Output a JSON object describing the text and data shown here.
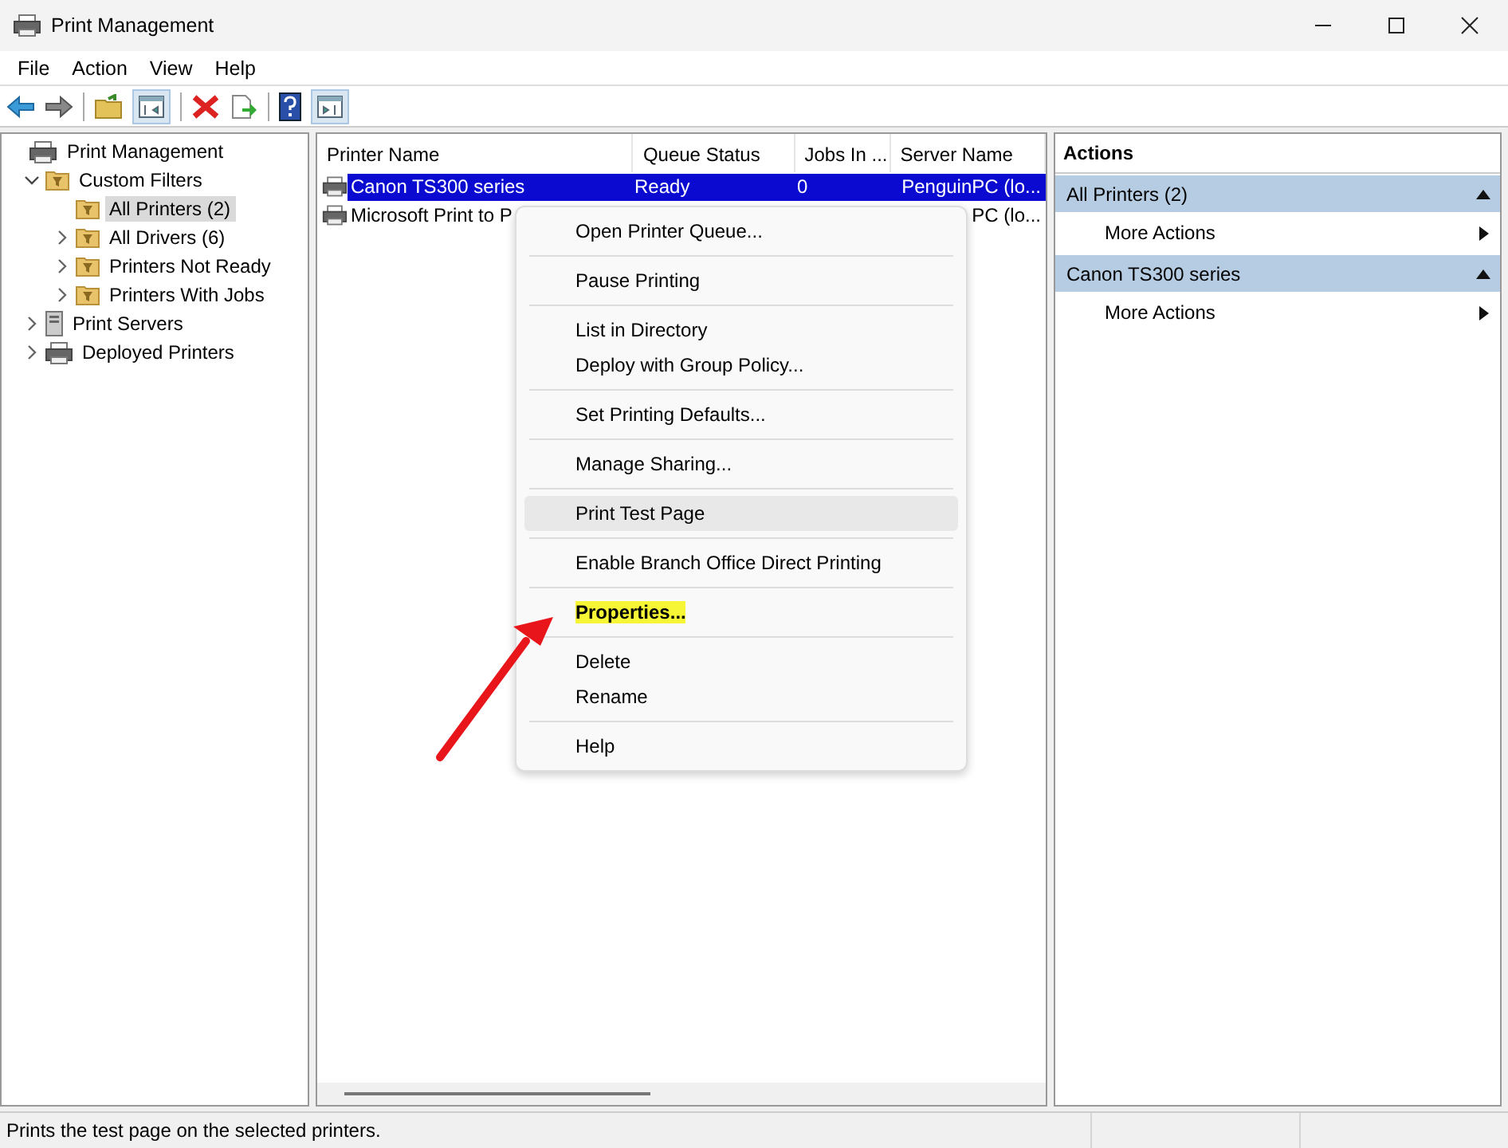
{
  "window": {
    "title": "Print Management"
  },
  "menu_bar": [
    "File",
    "Action",
    "View",
    "Help"
  ],
  "tree": [
    {
      "label": "Print Management",
      "kind": "printer",
      "selected": false,
      "children": [
        {
          "label": "Custom Filters",
          "kind": "filter",
          "expanded": true,
          "selected": false,
          "children": [
            {
              "label": "All Printers (2)",
              "kind": "filter",
              "selected": true
            },
            {
              "label": "All Drivers (6)",
              "kind": "filter",
              "expanded": false,
              "selected": false
            },
            {
              "label": "Printers Not Ready",
              "kind": "filter",
              "expanded": false,
              "selected": false
            },
            {
              "label": "Printers With Jobs",
              "kind": "filter",
              "expanded": false,
              "selected": false
            }
          ]
        },
        {
          "label": "Print Servers",
          "kind": "server",
          "expanded": false,
          "selected": false
        },
        {
          "label": "Deployed Printers",
          "kind": "printer",
          "expanded": false,
          "selected": false
        }
      ]
    }
  ],
  "table": {
    "columns": [
      "Printer Name",
      "Queue Status",
      "Jobs In ...",
      "Server Name"
    ],
    "rows": [
      {
        "selected": true,
        "cells": [
          "Canon TS300 series",
          "Ready",
          "0",
          "PenguinPC (lo..."
        ]
      },
      {
        "selected": false,
        "cells": [
          "Microsoft Print to P",
          "",
          "",
          "PC (lo..."
        ]
      }
    ]
  },
  "context_menu": [
    [
      {
        "label": "Open Printer Queue...",
        "hovered": false,
        "highlighted": false
      }
    ],
    [
      {
        "label": "Pause Printing",
        "hovered": false,
        "highlighted": false
      }
    ],
    [
      {
        "label": "List in Directory",
        "hovered": false,
        "highlighted": false
      },
      {
        "label": "Deploy with Group Policy...",
        "hovered": false,
        "highlighted": false
      }
    ],
    [
      {
        "label": "Set Printing Defaults...",
        "hovered": false,
        "highlighted": false
      }
    ],
    [
      {
        "label": "Manage Sharing...",
        "hovered": false,
        "highlighted": false
      }
    ],
    [
      {
        "label": "Print Test Page",
        "hovered": true,
        "highlighted": false
      }
    ],
    [
      {
        "label": "Enable Branch Office Direct Printing",
        "hovered": false,
        "highlighted": false
      }
    ],
    [
      {
        "label": "Properties...",
        "hovered": false,
        "highlighted": true
      }
    ],
    [
      {
        "label": "Delete",
        "hovered": false,
        "highlighted": false
      },
      {
        "label": "Rename",
        "hovered": false,
        "highlighted": false
      }
    ],
    [
      {
        "label": "Help",
        "hovered": false,
        "highlighted": false
      }
    ]
  ],
  "actions": {
    "title": "Actions",
    "sections": [
      {
        "title": "All Printers (2)",
        "expanded": true,
        "items": [
          "More Actions"
        ]
      },
      {
        "title": "Canon TS300 series",
        "expanded": true,
        "items": [
          "More Actions"
        ]
      }
    ]
  },
  "status_bar": {
    "text": "Prints the test page on the selected printers."
  }
}
